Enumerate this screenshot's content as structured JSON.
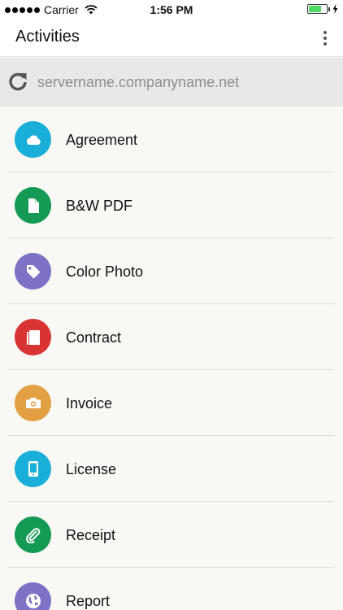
{
  "status_bar": {
    "carrier": "Carrier",
    "time": "1:56 PM",
    "battery_level": 0.7,
    "battery_color": "#4cd964"
  },
  "app_bar": {
    "title": "Activities",
    "menu_icon": "more-vert-icon"
  },
  "server": {
    "icon": "refresh-icon",
    "name": "servername.companyname.net"
  },
  "activities": [
    {
      "label": "Agreement",
      "icon": "cloud-icon",
      "color": "#1aafd8"
    },
    {
      "label": "B&W PDF",
      "icon": "file-icon",
      "color": "#159a55"
    },
    {
      "label": "Color Photo",
      "icon": "tag-icon",
      "color": "#7d72c6"
    },
    {
      "label": "Contract",
      "icon": "book-icon",
      "color": "#d83434"
    },
    {
      "label": "Invoice",
      "icon": "camera-icon",
      "color": "#e2a043"
    },
    {
      "label": "License",
      "icon": "phone-icon",
      "color": "#1aafd8"
    },
    {
      "label": "Receipt",
      "icon": "paperclip-icon",
      "color": "#159a55"
    },
    {
      "label": "Report",
      "icon": "globe-icon",
      "color": "#7d72c6"
    }
  ]
}
